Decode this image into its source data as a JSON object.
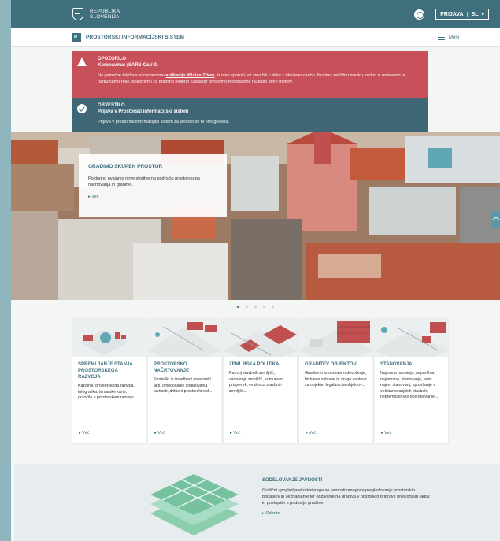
{
  "topbar": {
    "org_line1": "REPUBLIKA",
    "org_line2": "SLOVENIJA",
    "login_label": "PRIJAVA",
    "lang_label": "SL",
    "lang_caret": "▾"
  },
  "subheader": {
    "app_title": "PROSTORSKI INFORMACIJSKI SISTEM",
    "menu_label": "Meni"
  },
  "alerts": {
    "warning": {
      "title": "OPOZORILO",
      "subtitle": "Koronavirus (SARS-CoV-2)",
      "body_pre": "Na pametne telefone si namestimo ",
      "body_link": "aplikacijo #OstaniZdrav",
      "body_post": ", ki nam sporoči, ali smo bili v stiku z okuženo osebo. Nosimo zaščitno masko, redno si umivajmo in razkužujmo roke, poskrbimo za pravilno higieno kašlja ter ohranimo medosebno razdaljo dveh metrov."
    },
    "info": {
      "title": "OBVESTILO",
      "subtitle": "Prijava v Prostorski informacijski sistem",
      "body": "Prijava v prostorski informacijski sistem za javnost še ni omogočena."
    }
  },
  "hero": {
    "title": "GRADIMO SKUPEN PROSTOR",
    "text": "Postopno uvajamo nove storitve na področju prostorskega načrtovanja in graditve.",
    "more": "▸ Več"
  },
  "carousel": {
    "slides": 5,
    "active": 1
  },
  "cards": [
    {
      "title": "SPREMLJANJE STANJA PROSTORSKEGA RAZVOJA",
      "text": "Kazalniki prostorskega razvoja, infografika, tematske karte, poročila o prostorskem razvoju...",
      "more": "▸ Več"
    },
    {
      "title": "PROSTORSKO NAČRTOVANJE",
      "text": "Strateški in izvedbeni prostorski akti, omogočanje sodelovanja javnosti, državni prostorski red...",
      "more": "▸ Več"
    },
    {
      "title": "ZEMLJIŠKA POLITIKA",
      "text": "Razvoj stavbnih zemljišč, varovanje zemljišč, komunalni prispevek, evidenca stavbnih zemljišč...",
      "more": "▸ Več"
    },
    {
      "title": "GRADITEV OBJEKTOV",
      "text": "Gradbeno in uporabno dovoljenje, bistvene zahteve in druge zahteve za objekte, legalizacija objektov...",
      "more": "▸ Več"
    },
    {
      "title": "STANOVANJA",
      "text": "Najemna razmerja, neprofitna najemnina, stanovanja, javni najem stanovanj, upravljanje v večstanovanjskih stavbah, nepremičninsko posredovanje...",
      "more": "▸ Več"
    }
  ],
  "participation": {
    "title": "SODELOVANJE JAVNOSTI",
    "body": "Grafični vpogled preko katerega se javnosti omogoča pregledovanje prostorskih podatkov in seznanjanje ter odzivanje na gradiva v postopkih priprave prostorskih aktov in postopkih s področja graditve.",
    "more": "▸ Odprite"
  },
  "colors": {
    "brand": "#3f6e7c",
    "warning": "#c8505a",
    "info": "#3e6674",
    "accent_red": "#c0504f",
    "accent_teal": "#5fa7b3"
  }
}
